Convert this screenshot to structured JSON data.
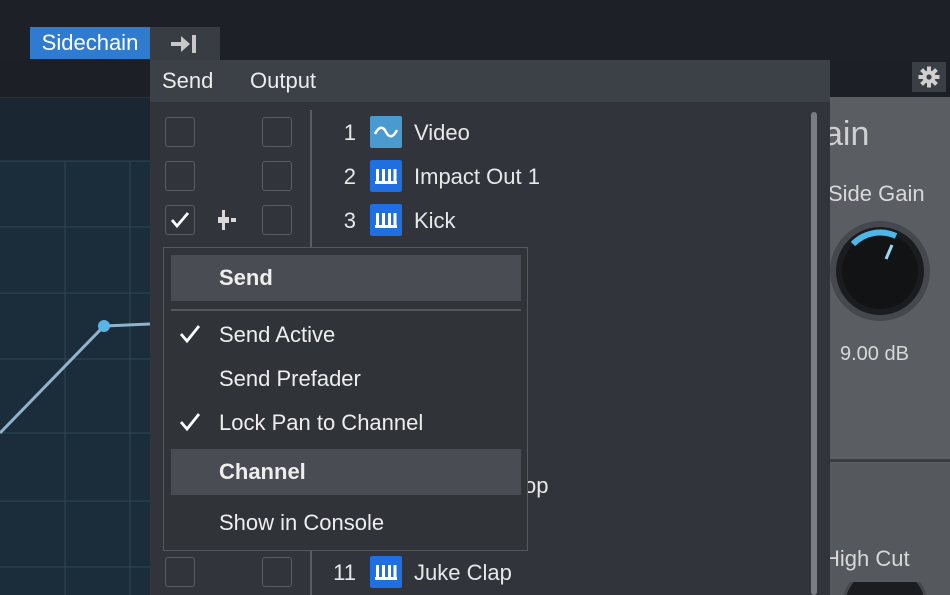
{
  "toolbar": {
    "sidechain_label": "Sidechain",
    "route_icon": "arrow-to-bar-icon",
    "settings_icon": "gear-icon"
  },
  "sends_popup": {
    "tabs": [
      "Send",
      "Output"
    ],
    "rows": [
      {
        "number": "1",
        "name": "Video",
        "icon": "waveform-icon",
        "send_checked": false,
        "output_checked": false
      },
      {
        "number": "2",
        "name": "Impact Out 1",
        "icon": "keyboard-icon",
        "send_checked": false,
        "output_checked": false
      },
      {
        "number": "3",
        "name": "Kick",
        "icon": "keyboard-icon",
        "send_checked": true,
        "output_checked": false
      },
      {
        "number": "11",
        "name": "Juke Clap",
        "icon": "keyboard-icon",
        "send_checked": false,
        "output_checked": false
      }
    ],
    "partial_row_fragment": "op"
  },
  "context_menu": {
    "send_header": "Send",
    "items": [
      {
        "label": "Send Active",
        "checked": true
      },
      {
        "label": "Send Prefader",
        "checked": false
      },
      {
        "label": "Lock Pan to Channel",
        "checked": true
      }
    ],
    "channel_header": "Channel",
    "channel_items": [
      {
        "label": "Show in Console"
      }
    ]
  },
  "right_panel": {
    "title_fragment": "ain",
    "knob_label": "Side Gain",
    "knob_value": "9.00 dB",
    "knob_level": 0.62,
    "lower_label": "High Cut"
  },
  "colors": {
    "accent": "#2f7bcf",
    "track_icon_blue": "#1f6fe0",
    "video_icon": "#4a9ad0",
    "knob_ring": "#4fb7e8"
  }
}
